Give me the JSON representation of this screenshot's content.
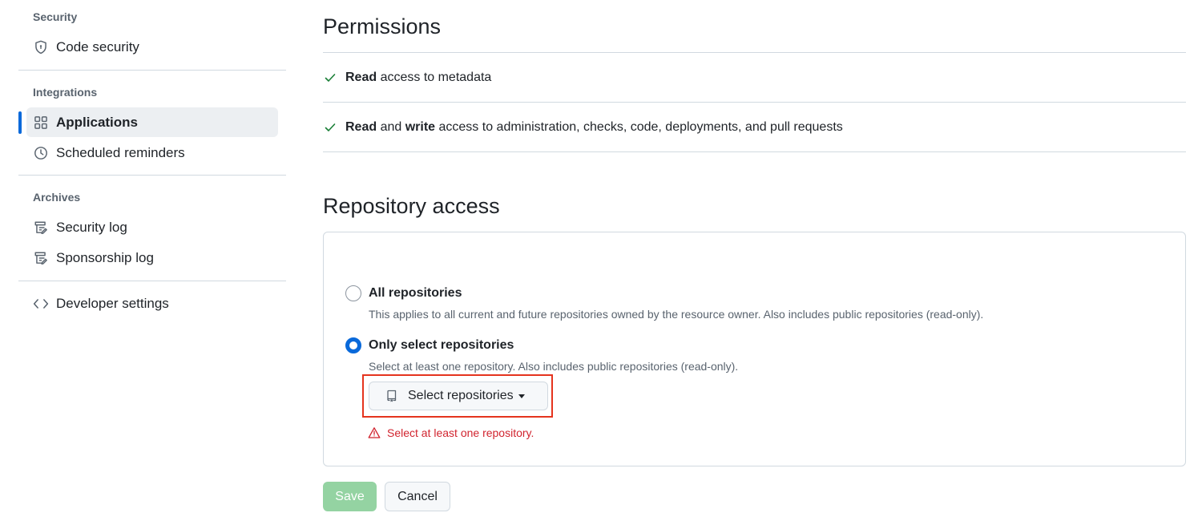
{
  "sidebar": {
    "security_heading": "Security",
    "code_security": "Code security",
    "integrations_heading": "Integrations",
    "applications": "Applications",
    "scheduled_reminders": "Scheduled reminders",
    "archives_heading": "Archives",
    "security_log": "Security log",
    "sponsorship_log": "Sponsorship log",
    "developer_settings": "Developer settings"
  },
  "permissions": {
    "title": "Permissions",
    "row1": {
      "bold1": "Read",
      "rest": " access to metadata"
    },
    "row2": {
      "bold1": "Read",
      "mid": " and ",
      "bold2": "write",
      "rest": " access to administration, checks, code, deployments, and pull requests"
    }
  },
  "repository_access": {
    "title": "Repository access",
    "all": {
      "label": "All repositories",
      "description": "This applies to all current and future repositories owned by the resource owner. Also includes public repositories (read-only).",
      "selected": false
    },
    "select": {
      "label": "Only select repositories",
      "description": "Select at least one repository. Also includes public repositories (read-only).",
      "selected": true
    },
    "select_button": "Select repositories",
    "error": "Select at least one repository."
  },
  "actions": {
    "save": "Save",
    "cancel": "Cancel"
  },
  "colors": {
    "accent": "#0969da",
    "success": "#1a7f37",
    "danger": "#d1242f",
    "highlight": "#e5341e",
    "save_disabled": "#94d3a2"
  }
}
